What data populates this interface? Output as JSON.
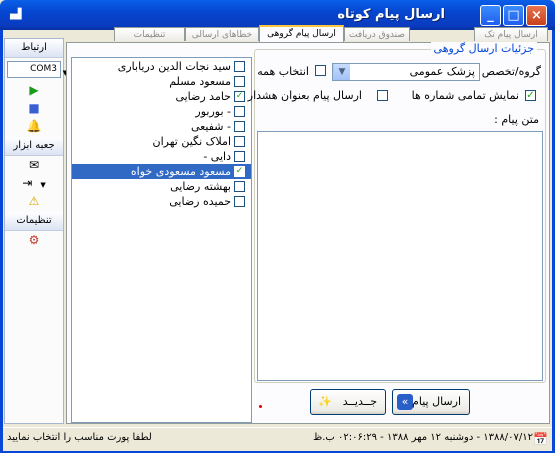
{
  "window": {
    "title": "ارسال پیام کوتاه",
    "buttons": {
      "minimize": "_",
      "maximize": "□",
      "close": "×"
    }
  },
  "leftbar": {
    "connection_label": "ارتباط",
    "port_value": "COM3",
    "toolbox_label": "جعبه ابزار",
    "settings_label": "تنظیمات"
  },
  "tabs": [
    {
      "label": "ارسال پیام تک"
    },
    {
      "label": "ارسال پیام گروهی"
    },
    {
      "label": "صندوق دریافت"
    },
    {
      "label": "خطاهای ارسالی"
    },
    {
      "label": "تنظیمات"
    }
  ],
  "contacts": [
    {
      "name": "سید نجات الدین دریاباری",
      "checked": false
    },
    {
      "name": "مسعود مسلم",
      "checked": false
    },
    {
      "name": "حامد رضایی",
      "checked": true
    },
    {
      "name": "- بوربور",
      "checked": false
    },
    {
      "name": "- شفیعی",
      "checked": false
    },
    {
      "name": "املاک نگین تهران",
      "checked": false
    },
    {
      "name": "دایی -",
      "checked": false
    },
    {
      "name": "مسعود مسعودی خواه",
      "checked": true,
      "selected": true
    },
    {
      "name": "بهشته رضایی",
      "checked": false
    },
    {
      "name": "حمیده رضایی",
      "checked": false
    }
  ],
  "group": {
    "legend": "جزئیات ارسال گروهی",
    "group_label": "گروه/تخصص :",
    "group_value": "پزشک عمومی",
    "select_all_label": "انتخاب همه",
    "select_all_checked": false,
    "show_all_numbers_label": "نمایش تمامی شماره ها",
    "show_all_numbers_checked": true,
    "send_as_alert_label": "ارسال پیام بعنوان هشدار",
    "send_as_alert_checked": false,
    "message_label": "متن پیام :",
    "message_text": ""
  },
  "buttons": {
    "send_label": "ارسال پیام",
    "new_label": "جــدیــد"
  },
  "status": {
    "left_text": "لطفا پورت مناسب را انتخاب نمایید",
    "right_text": "۱۳۸۸/۰۷/۱۲ - دوشنبه ۱۲ مهر ۱۳۸۸ - ۰۲:۰۶:۲۹ ب.ظ"
  },
  "colors": {
    "titlebar": "#0a5fe8",
    "legend": "#0046d5",
    "selection": "#316ac5"
  }
}
